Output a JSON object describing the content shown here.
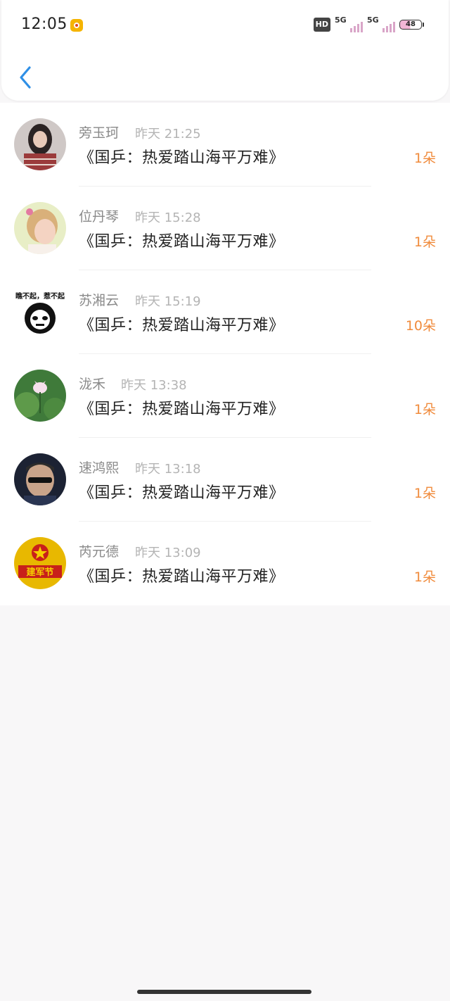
{
  "status_bar": {
    "time": "12:05",
    "hd_label": "HD",
    "network1": "5G",
    "network2": "5G",
    "battery": "48"
  },
  "nav": {
    "back_icon": "chevron-left-icon"
  },
  "list": [
    {
      "name": "旁玉珂",
      "time": "昨天 21:25",
      "title": "《国乒：热爱踏山海平万难》",
      "count": "1朵"
    },
    {
      "name": "位丹琴",
      "time": "昨天 15:28",
      "title": "《国乒：热爱踏山海平万难》",
      "count": "1朵"
    },
    {
      "name": "苏湘云",
      "time": "昨天 15:19",
      "title": "《国乒：热爱踏山海平万难》",
      "count": "10朵"
    },
    {
      "name": "泷禾",
      "time": "昨天 13:38",
      "title": "《国乒：热爱踏山海平万难》",
      "count": "1朵"
    },
    {
      "name": "速鸿熙",
      "time": "昨天 13:18",
      "title": "《国乒：热爱踏山海平万难》",
      "count": "1朵"
    },
    {
      "name": "芮元德",
      "time": "昨天 13:09",
      "title": "《国乒：热爱踏山海平万难》",
      "count": "1朵"
    }
  ],
  "avatar_text": {
    "panda": "瞧不起，惹不起",
    "banner": "建军节"
  },
  "colors": {
    "accent": "#2f8fe6",
    "count": "#f08b3c"
  }
}
